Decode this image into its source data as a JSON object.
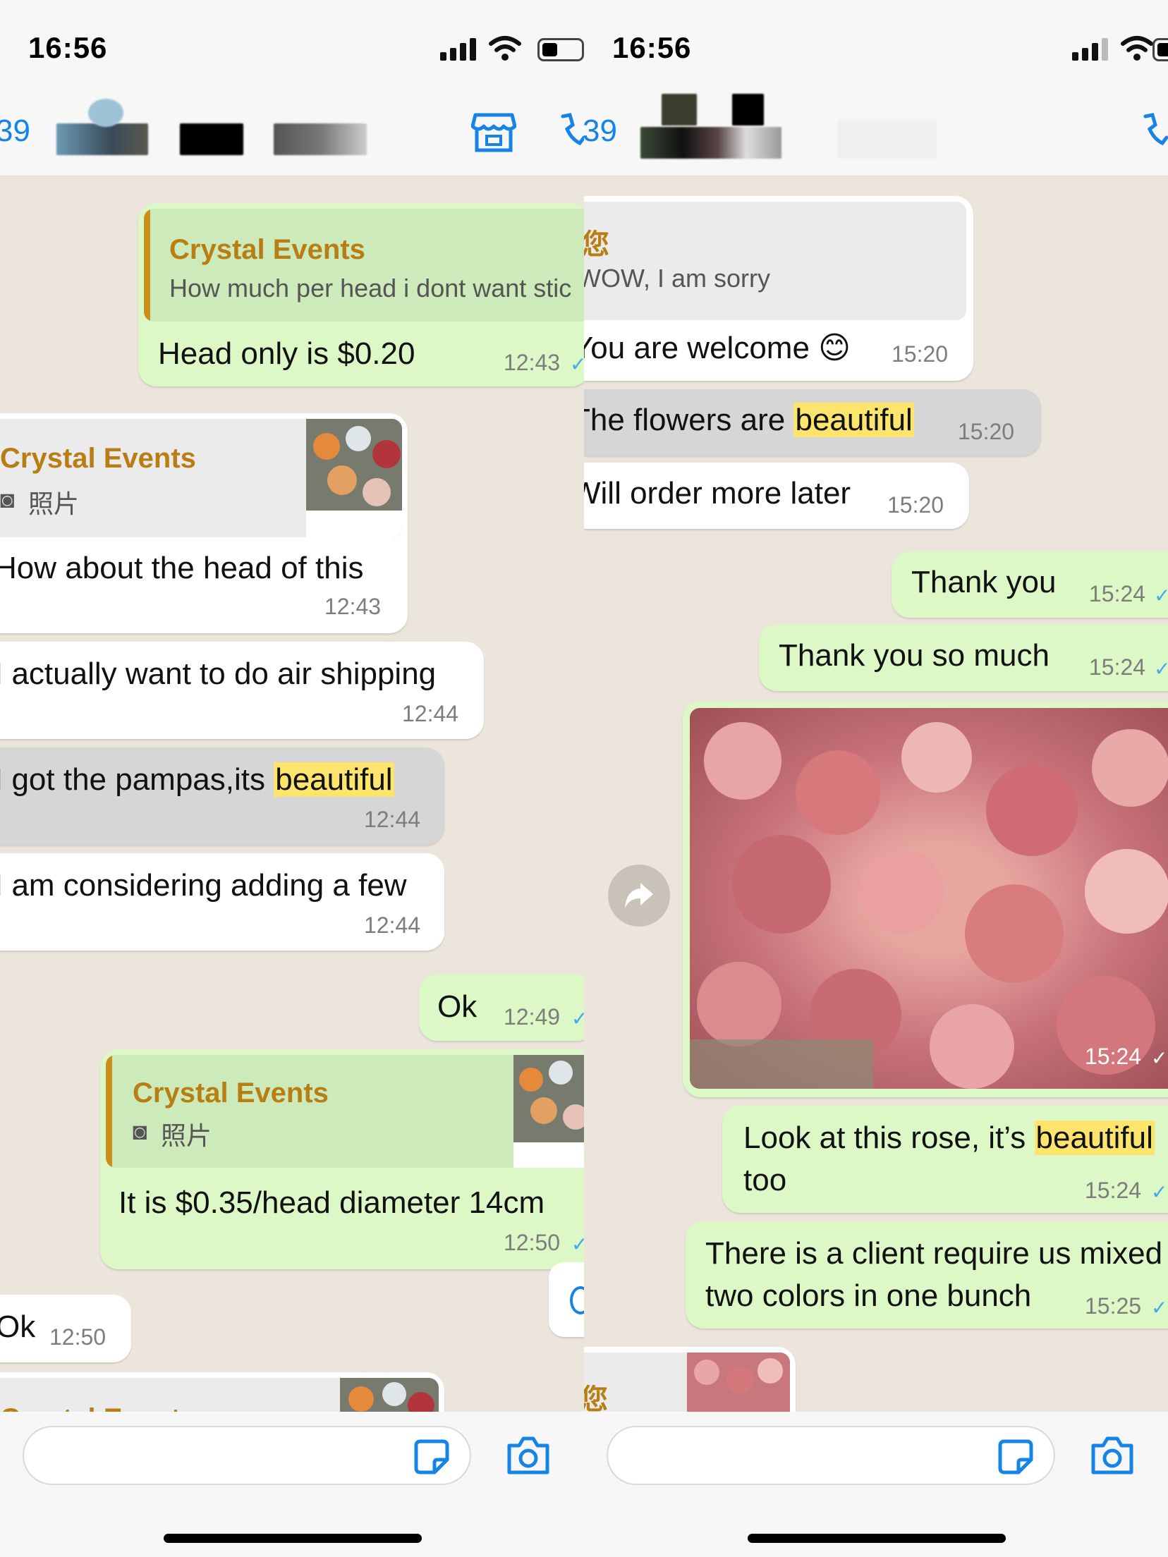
{
  "status_bar": {
    "time": "16:56"
  },
  "left": {
    "header": {
      "number": "39"
    },
    "messages": [
      {
        "quote_name": "Crystal Events",
        "quote_text": "How much per head i dont want stic",
        "text": "Head only is $0.20",
        "time": "12:43"
      },
      {
        "quote_name": "Crystal Events",
        "quote_text": "照片",
        "text": "How about the head of this",
        "time": "12:43"
      },
      {
        "text": "I actually want to do air shipping",
        "time": "12:44"
      },
      {
        "text_before": "I got the pampas,its ",
        "highlight": "beautiful",
        "time": "12:44"
      },
      {
        "text": "I am considering adding a few",
        "time": "12:44"
      },
      {
        "text": "Ok",
        "time": "12:49"
      },
      {
        "quote_name": "Crystal Events",
        "quote_text": "照片",
        "text": "It is $0.35/head diameter 14cm",
        "time": "12:50"
      },
      {
        "text": "Ok",
        "time": "12:50"
      },
      {
        "quote_name": "Crystal Events"
      }
    ]
  },
  "right": {
    "header": {
      "number": "39"
    },
    "messages": [
      {
        "quote_name": "您",
        "quote_text": "WOW, I am sorry",
        "text": "You are welcome 😊",
        "time": "15:20"
      },
      {
        "text_before": "The flowers are ",
        "highlight": "beautiful",
        "time": "15:20"
      },
      {
        "text": "Will order more later",
        "time": "15:20"
      },
      {
        "text": "Thank you",
        "time": "15:24"
      },
      {
        "text": "Thank you so much",
        "time": "15:24"
      },
      {
        "image": "roses-photo",
        "time": "15:24"
      },
      {
        "text_before": "Look at this rose, it’s ",
        "highlight": "beautiful",
        "line2": "too",
        "time": "15:24"
      },
      {
        "line1": "There is a client require us mixed",
        "line2": "two colors in one bunch",
        "time": "15:25"
      },
      {
        "quote_name": "您"
      }
    ]
  }
}
